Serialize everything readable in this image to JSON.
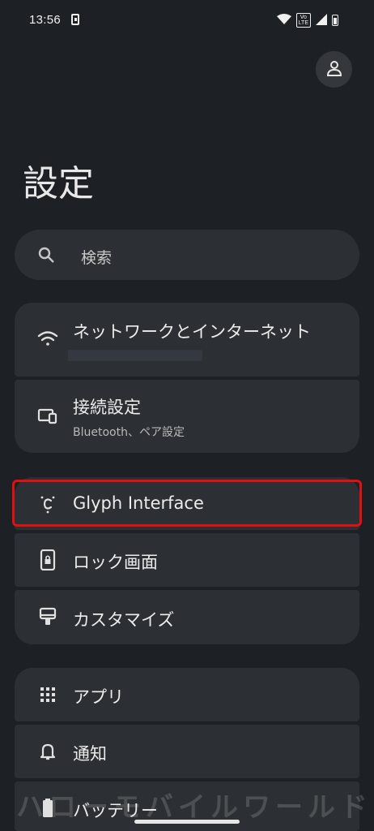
{
  "status_bar": {
    "time": "13:56",
    "network_badge_top": "Vo",
    "network_badge_bottom": "LTE"
  },
  "page": {
    "title": "設定"
  },
  "search": {
    "placeholder": "検索"
  },
  "groups": [
    {
      "items": [
        {
          "title": "ネットワークとインターネット",
          "subtitle": "",
          "icon": "wifi-icon"
        },
        {
          "title": "接続設定",
          "subtitle": "Bluetooth、ペア設定",
          "icon": "connected-devices-icon"
        }
      ]
    },
    {
      "items": [
        {
          "title": "Glyph Interface",
          "icon": "glyph-icon",
          "highlighted": true
        },
        {
          "title": "ロック画面",
          "icon": "lock-screen-icon"
        },
        {
          "title": "カスタマイズ",
          "icon": "customize-icon"
        }
      ]
    },
    {
      "items": [
        {
          "title": "アプリ",
          "icon": "apps-grid-icon"
        },
        {
          "title": "通知",
          "icon": "bell-icon"
        },
        {
          "title": "バッテリー",
          "icon": "battery-icon"
        }
      ]
    }
  ],
  "watermark": {
    "text": "ハローモバイルワールド"
  },
  "colors": {
    "background": "#1d2024",
    "card": "#2c2f33",
    "highlight": "#e01010",
    "text": "#ececec"
  }
}
